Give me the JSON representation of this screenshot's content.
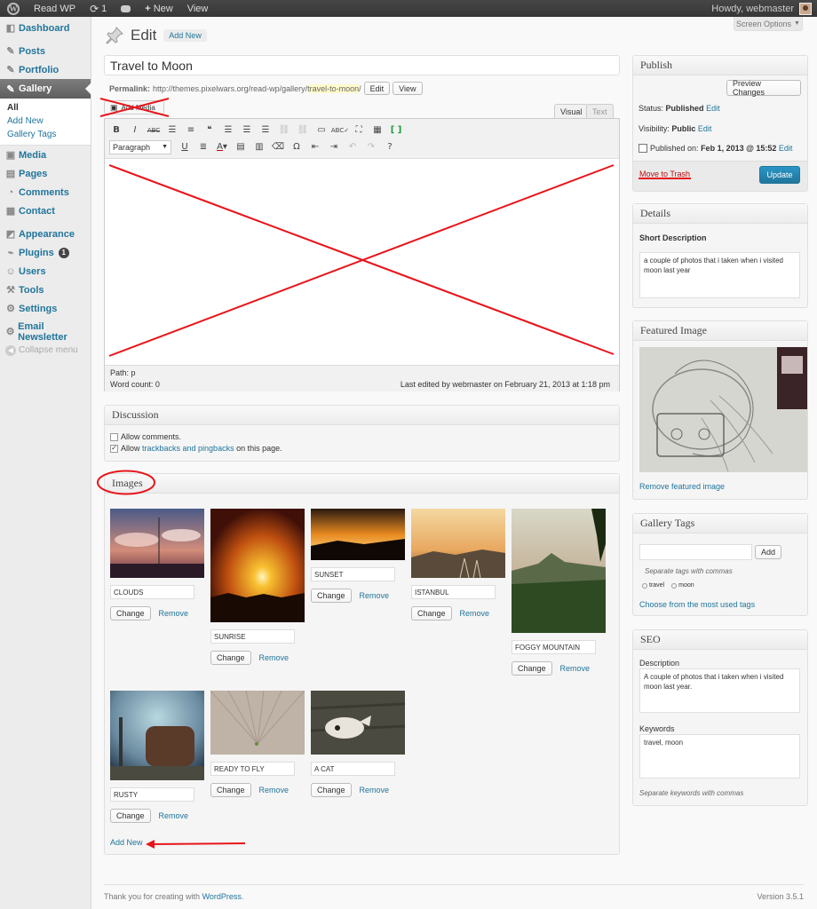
{
  "adminbar": {
    "site_name": "Read WP",
    "updates_count": "1",
    "new_label": "New",
    "view_label": "View",
    "howdy": "Howdy, webmaster"
  },
  "sidebar": {
    "items": [
      {
        "label": "Dashboard",
        "icon": "dashboard-icon"
      },
      {
        "label": "Posts",
        "icon": "pin-icon"
      },
      {
        "label": "Portfolio",
        "icon": "pin-icon"
      },
      {
        "label": "Gallery",
        "icon": "pin-icon"
      },
      {
        "label": "Media",
        "icon": "media-icon"
      },
      {
        "label": "Pages",
        "icon": "page-icon"
      },
      {
        "label": "Comments",
        "icon": "comments-icon"
      },
      {
        "label": "Contact",
        "icon": "contact-icon"
      },
      {
        "label": "Appearance",
        "icon": "appearance-icon"
      },
      {
        "label": "Plugins",
        "icon": "plugins-icon",
        "badge": "1"
      },
      {
        "label": "Users",
        "icon": "users-icon"
      },
      {
        "label": "Tools",
        "icon": "tools-icon"
      },
      {
        "label": "Settings",
        "icon": "settings-icon"
      },
      {
        "label": "Email Newsletter",
        "icon": "gear-icon"
      },
      {
        "label": "Collapse menu",
        "icon": "collapse-icon"
      }
    ],
    "submenu": [
      "All",
      "Add New",
      "Gallery Tags"
    ]
  },
  "header": {
    "title": "Edit",
    "add_new": "Add New",
    "screen_options": "Screen Options"
  },
  "post": {
    "title": "Travel to Moon",
    "permalink_label": "Permalink:",
    "permalink_base": "http://themes.pixelwars.org/read-wp/gallery/",
    "permalink_slug": "travel-to-moon",
    "permalink_end": "/",
    "edit_btn": "Edit",
    "view_btn": "View"
  },
  "editor": {
    "add_media": "Add Media",
    "tab_visual": "Visual",
    "tab_text": "Text",
    "format": "Paragraph",
    "path": "Path: p",
    "word_count": "Word count: 0",
    "last_edited": "Last edited by webmaster on February 21, 2013 at 1:18 pm"
  },
  "discussion": {
    "title": "Discussion",
    "allow_comments": "Allow comments.",
    "allow_prefix": "Allow ",
    "trackbacks_link": "trackbacks and pingbacks",
    "allow_suffix": " on this page."
  },
  "images": {
    "title": "Images",
    "change": "Change",
    "remove": "Remove",
    "add_new": "Add New",
    "items": [
      {
        "caption": "CLOUDS"
      },
      {
        "caption": "SUNRISE"
      },
      {
        "caption": "SUNSET"
      },
      {
        "caption": "ISTANBUL"
      },
      {
        "caption": "FOGGY MOUNTAIN"
      },
      {
        "caption": "RUSTY"
      },
      {
        "caption": "READY TO FLY"
      },
      {
        "caption": "A CAT"
      }
    ]
  },
  "publish": {
    "title": "Publish",
    "preview": "Preview Changes",
    "status_label": "Status:",
    "status_value": "Published",
    "visibility_label": "Visibility:",
    "visibility_value": "Public",
    "published_label": "Published on:",
    "published_value": "Feb 1, 2013 @ 15:52",
    "edit": "Edit",
    "trash": "Move to Trash",
    "update": "Update"
  },
  "details": {
    "title": "Details",
    "short_desc_label": "Short Description",
    "short_desc_value": "a couple of photos that i taken when i visited moon last year"
  },
  "featured": {
    "title": "Featured Image",
    "remove": "Remove featured image"
  },
  "tags": {
    "title": "Gallery Tags",
    "add": "Add",
    "hint": "Separate tags with commas",
    "tag1": "travel",
    "tag2": "moon",
    "choose": "Choose from the most used tags"
  },
  "seo": {
    "title": "SEO",
    "desc_label": "Description",
    "desc_value": "A couple of photos that i taken when i visited moon last year.",
    "kw_label": "Keywords",
    "kw_value": "travel, moon",
    "hint": "Separate keywords with commas"
  },
  "footer": {
    "thanks_prefix": "Thank you for creating with ",
    "wordpress": "WordPress",
    "thanks_suffix": ".",
    "version": "Version 3.5.1"
  },
  "colors": {
    "accent": "#21759b",
    "annotation": "#e8151b",
    "adminbar": "#464646"
  }
}
